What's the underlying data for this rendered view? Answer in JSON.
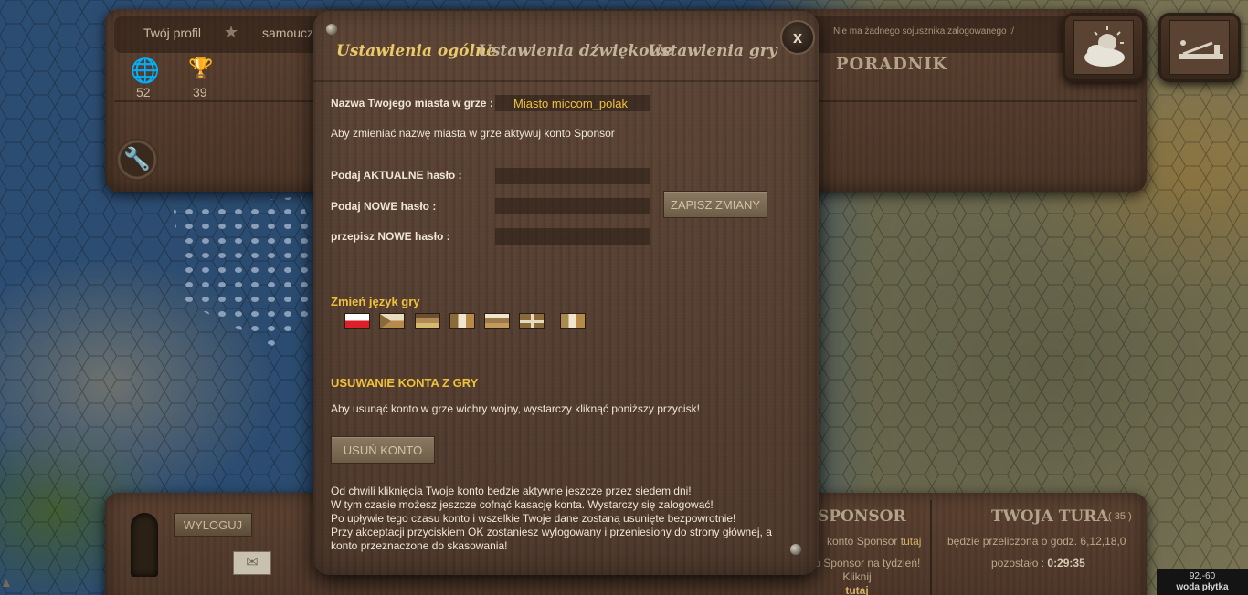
{
  "top": {
    "profile_link": "Twój profil",
    "rank_link": "samouczek",
    "ally_status": "Nie ma żadnego sojusznika zalogowanego :/",
    "stat_globe_value": "52",
    "stat_trophy_value": "39",
    "guide_label": "PORADNIK"
  },
  "bottom": {
    "logout_label": "WYLOGUJ",
    "sponsor_title": "SPONSOR",
    "sponsor_line1_prefix": "konto Sponsor",
    "sponsor_line1_link": "tutaj",
    "sponsor_text": "konto Sponsor na tydzień! Kliknij",
    "sponsor_text_link": "tutaj",
    "turn_title": "TWOJA TURA",
    "turn_number": "( 35 )",
    "turn_recalc": "będzie przeliczona o godz. 6,12,18,0",
    "turn_left_label": "pozostało :",
    "turn_left_value": "0:29:35",
    "coords_value": "92,-60",
    "coords_terrain": "woda płytka"
  },
  "modal": {
    "tabs": [
      {
        "label": "Ustawienia ogólne",
        "active": true
      },
      {
        "label": "Ustawienia dźwiękowe",
        "active": false
      },
      {
        "label": "Ustawienia gry",
        "active": false
      }
    ],
    "close_label": "x",
    "city_name_label": "Nazwa Twojego miasta w grze :",
    "city_name_value": "Miasto miccom_polak",
    "sponsor_note": "Aby zmieniać nazwę miasta w grze aktywuj konto Sponsor",
    "current_password_label": "Podaj AKTUALNE hasło :",
    "new_password_label": "Podaj NOWE hasło :",
    "repeat_password_label": "przepisz NOWE hasło :",
    "save_button": "ZAPISZ ZMIANY",
    "language_title": "Zmień język gry",
    "languages": [
      "pl-flag",
      "cz-flag",
      "de-flag",
      "fr-flag",
      "ru-flag",
      "gb-flag",
      "it-flag"
    ],
    "delete_title": "USUWANIE KONTA Z GRY",
    "delete_note": "Aby usunąć konto w grze wichry wojny, wystarczy kliknąć poniższy przycisk!",
    "delete_button": "USUŃ KONTO",
    "delete_info": [
      "Od chwili kliknięcia Twoje konto bedzie aktywne jeszcze przez siedem dni!",
      "W tym czasie możesz jeszcze cofnąć kasację konta. Wystarczy się zalogować!",
      "Po upływie tego czasu konto i wszelkie Twoje dane zostaną usunięte bezpowrotnie!",
      "Przy akceptacji przyciskiem OK zostaniesz wylogowany i przeniesiony do strony głównej, a",
      "konto przeznaczone do skasowania!"
    ]
  },
  "colors": {
    "accent_gold": "#f0c23a",
    "tab_active": "#e9c96a",
    "wood": "#574032"
  }
}
